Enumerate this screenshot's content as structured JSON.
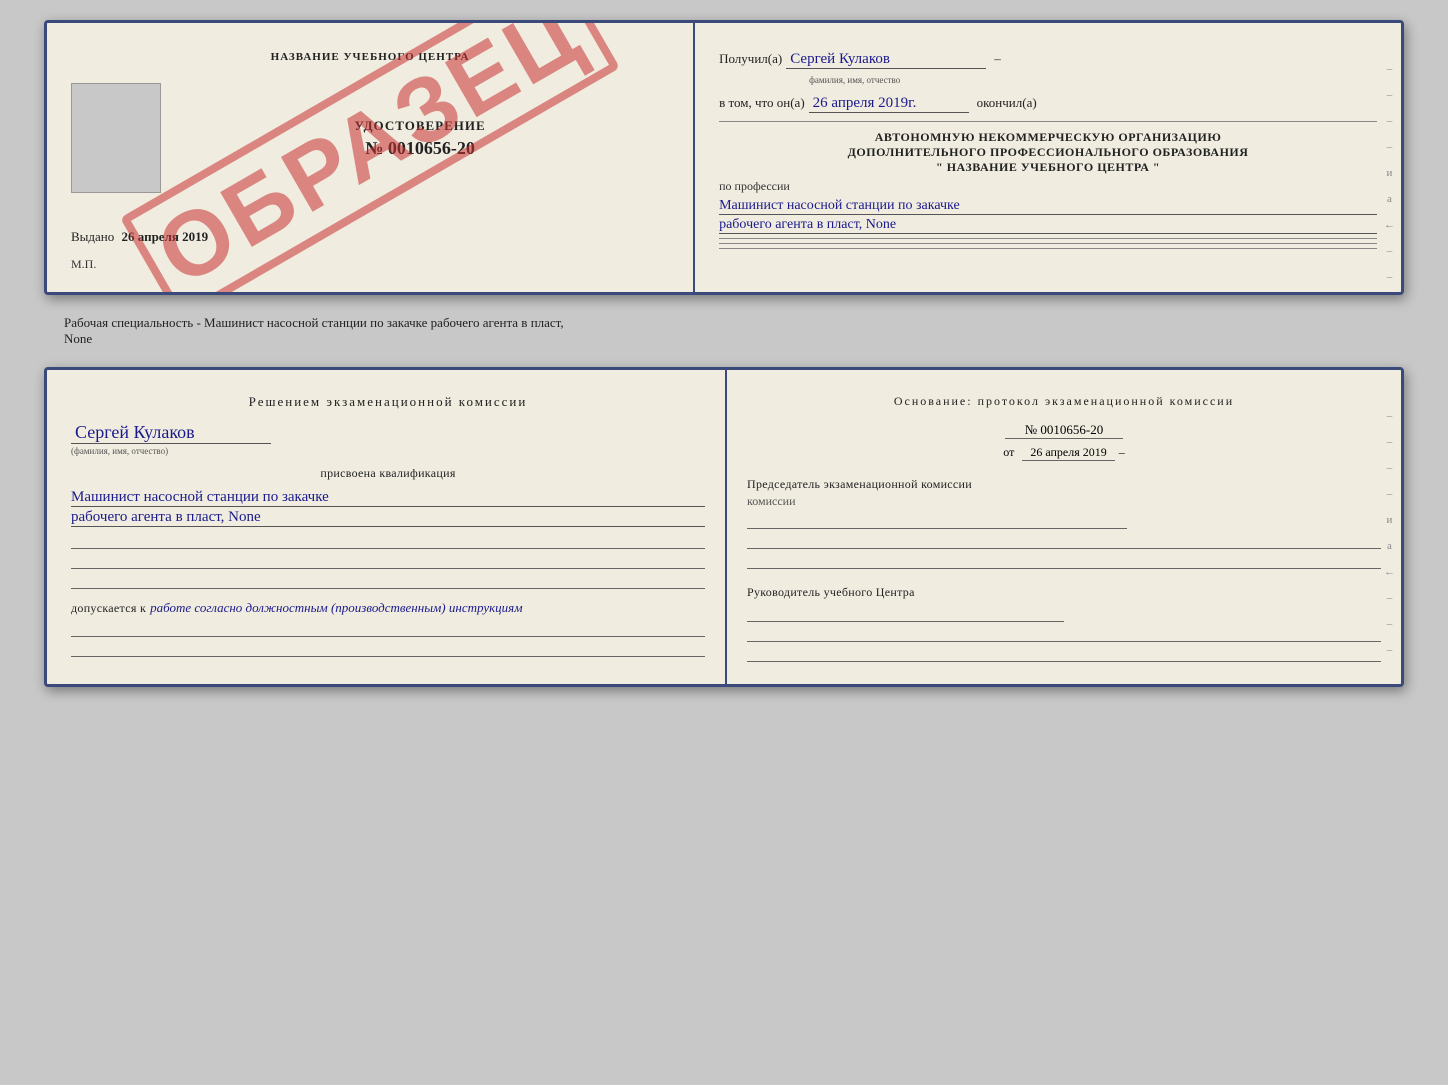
{
  "doc1": {
    "left": {
      "title": "НАЗВАНИЕ УЧЕБНОГО ЦЕНТРА",
      "stamp_text": "ОБРАЗЕЦ",
      "udostoverenie_title": "УДОСТОВЕРЕНИЕ",
      "udostoverenie_number": "№ 0010656-20",
      "vydano_label": "Выдано",
      "vydano_date": "26 апреля 2019",
      "mp_label": "М.П."
    },
    "right": {
      "poluchil_label": "Получил(а)",
      "poluchil_name": "Сергей Кулаков",
      "familiya_hint": "фамилия, имя, отчество",
      "dash": "–",
      "vtom_label": "в том, что он(а)",
      "vtom_date": "26 апреля 2019г.",
      "okonchil_label": "окончил(а)",
      "section1_line1": "АВТОНОМНУЮ НЕКОММЕРЧЕСКУЮ ОРГАНИЗАЦИЮ",
      "section1_line2": "ДОПОЛНИТЕЛЬНОГО ПРОФЕССИОНАЛЬНОГО ОБРАЗОВАНИЯ",
      "section1_line3": "\"    НАЗВАНИЕ УЧЕБНОГО ЦЕНТРА    \"",
      "po_professii_label": "по профессии",
      "profession_line1": "Машинист насосной станции по закачке",
      "profession_line2": "рабочего агента в пласт, None",
      "side_dashes": [
        "–",
        "–",
        "–",
        "–",
        "и",
        "а",
        "←",
        "–",
        "–",
        "–"
      ]
    }
  },
  "bottom_text": "Рабочая специальность - Машинист насосной станции по закачке рабочего агента в пласт,",
  "bottom_text2": "None",
  "doc2": {
    "left": {
      "resheniem_label": "Решением экзаменационной комиссии",
      "name_handwritten": "Сергей Кулаков",
      "familiya_hint": "(фамилия, имя, отчество)",
      "prisvoena_label": "присвоена квалификация",
      "qualification_line1": "Машинист насосной станции по закачке",
      "qualification_line2": "рабочего агента в пласт, None",
      "dopuskaetsya_label": "допускается к",
      "dopuskaetsya_text": "работе согласно должностным (производственным) инструкциям"
    },
    "right": {
      "osnovanie_label": "Основание: протокол экзаменационной комиссии",
      "protocol_number": "№ 0010656-20",
      "ot_label": "от",
      "ot_date": "26 апреля 2019",
      "predsedatel_label": "Председатель экзаменационной комиссии",
      "rukovoditel_label": "Руководитель учебного Центра",
      "side_dashes": [
        "–",
        "–",
        "–",
        "–",
        "и",
        "а",
        "←",
        "–",
        "–",
        "–"
      ]
    }
  }
}
